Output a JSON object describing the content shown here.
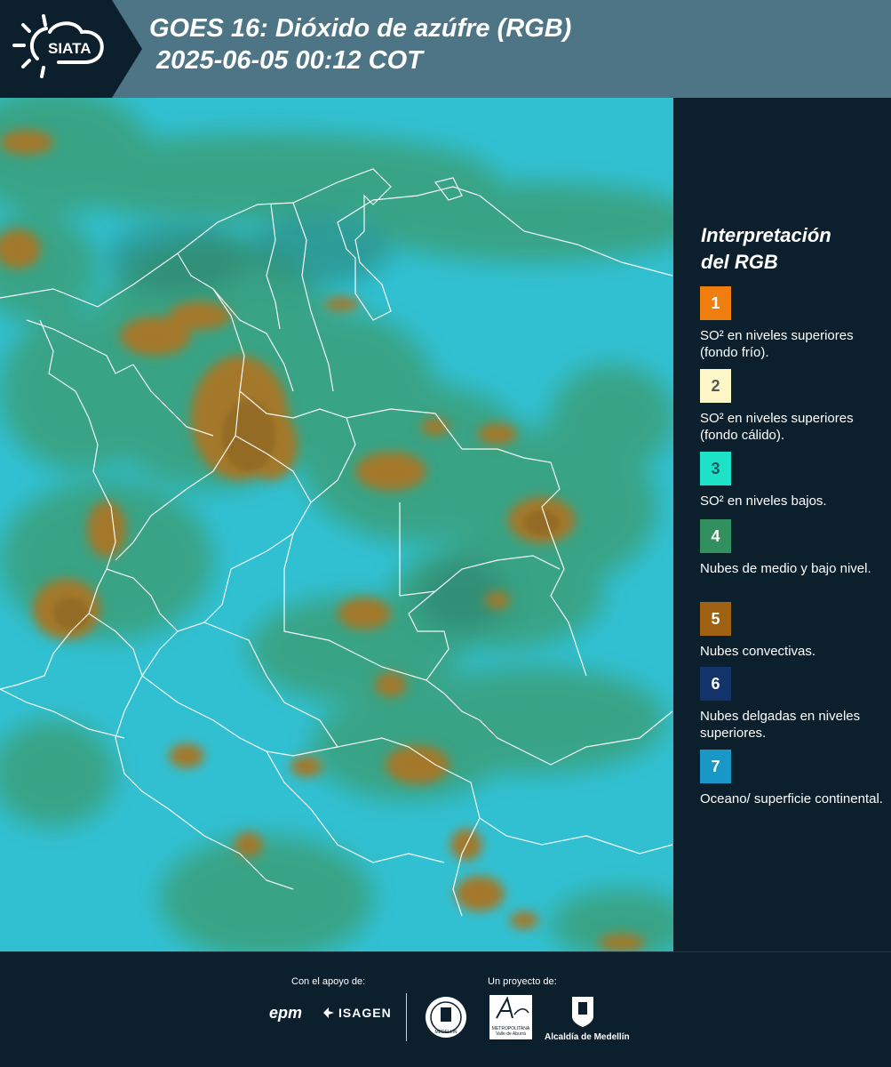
{
  "header": {
    "logo_text": "SIATA",
    "title_line1": "GOES 16: Dióxido de azúfre (RGB)",
    "title_line2": " 2025-06-05 00:12 COT"
  },
  "legend": {
    "title_line1": "Interpretación",
    "title_line2": "del RGB",
    "items": [
      {
        "number": "1",
        "color": "#f07d10",
        "text_color": "#ffffff",
        "label": "SO² en niveles superiores (fondo frío)."
      },
      {
        "number": "2",
        "color": "#fdf6c6",
        "text_color": "#555555",
        "label": "SO² en niveles superiores (fondo cálido)."
      },
      {
        "number": "3",
        "color": "#1de2c8",
        "text_color": "#1a5a60",
        "label": "SO² en niveles bajos."
      },
      {
        "number": "4",
        "color": "#32905f",
        "text_color": "#ffffff",
        "label": "Nubes de medio y bajo nivel."
      },
      {
        "number": "5",
        "color": "#9e6212",
        "text_color": "#ffffff",
        "label": "Nubes convectivas."
      },
      {
        "number": "6",
        "color": "#12346a",
        "text_color": "#ffffff",
        "label": "Nubes delgadas en niveles superiores."
      },
      {
        "number": "7",
        "color": "#1998c8",
        "text_color": "#ffffff",
        "label": "Oceano/ superficie continental."
      }
    ]
  },
  "footer": {
    "support_label": "Con el apoyo de:",
    "project_label": "Un proyecto de:",
    "sponsor_epm": "epm",
    "sponsor_isagen": "ISAGEN",
    "partner_area_line1": "METROPOLITANA",
    "partner_area_line2": "Valle de Aburrá",
    "partner_alcaldia": "Alcaldía de Medellín",
    "seal_text": "MEDELLÍN"
  },
  "map": {
    "background_color": "#2ec4d8",
    "cloud_color": "#3a9f78",
    "convective_color": "#a3782c",
    "border_color": "#ffffff"
  }
}
